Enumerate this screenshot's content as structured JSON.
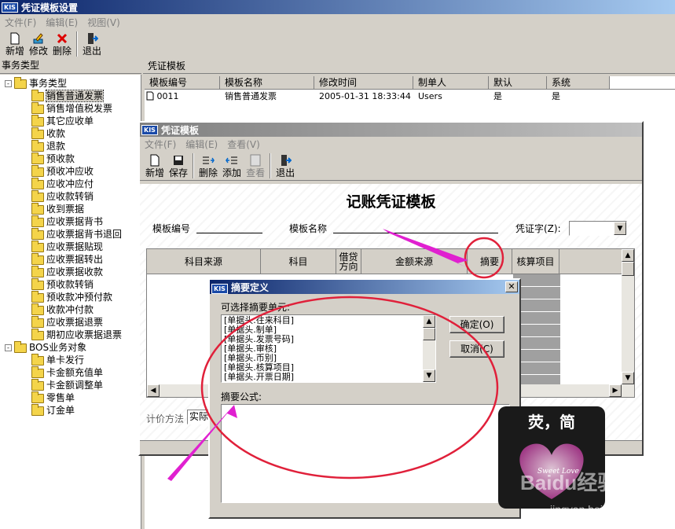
{
  "main_window": {
    "title": "凭证模板设置",
    "menus": [
      "文件(F)",
      "编辑(E)",
      "视图(V)"
    ],
    "toolbar": [
      "新增",
      "修改",
      "删除",
      "退出"
    ]
  },
  "left_panel": {
    "header": "事务类型",
    "tree": [
      {
        "label": "事务类型",
        "level": 0,
        "toggle": "-"
      },
      {
        "label": "销售普通发票",
        "level": 1,
        "selected": true
      },
      {
        "label": "销售增值税发票",
        "level": 1
      },
      {
        "label": "其它应收单",
        "level": 1
      },
      {
        "label": "收款",
        "level": 1
      },
      {
        "label": "退款",
        "level": 1
      },
      {
        "label": "预收款",
        "level": 1
      },
      {
        "label": "预收冲应收",
        "level": 1
      },
      {
        "label": "应收冲应付",
        "level": 1
      },
      {
        "label": "应收款转销",
        "level": 1
      },
      {
        "label": "收到票据",
        "level": 1
      },
      {
        "label": "应收票据背书",
        "level": 1
      },
      {
        "label": "应收票据背书退回",
        "level": 1
      },
      {
        "label": "应收票据贴现",
        "level": 1
      },
      {
        "label": "应收票据转出",
        "level": 1
      },
      {
        "label": "应收票据收款",
        "level": 1
      },
      {
        "label": "预收款转销",
        "level": 1
      },
      {
        "label": "预收款冲预付款",
        "level": 1
      },
      {
        "label": "收款冲付款",
        "level": 1
      },
      {
        "label": "应收票据退票",
        "level": 1
      },
      {
        "label": "期初应收票据退票",
        "level": 1
      },
      {
        "label": "BOS业务对象",
        "level": 0,
        "toggle": "-"
      },
      {
        "label": "单卡发行",
        "level": 1
      },
      {
        "label": "卡金额充值单",
        "level": 1
      },
      {
        "label": "卡金额调整单",
        "level": 1
      },
      {
        "label": "零售单",
        "level": 1
      },
      {
        "label": "订金单",
        "level": 1
      }
    ]
  },
  "right_panel": {
    "header": "凭证模板",
    "columns": [
      "模板编号",
      "模板名称",
      "修改时间",
      "制单人",
      "默认",
      "系统"
    ],
    "rows": [
      [
        "0011",
        "销售普通发票",
        "2005-01-31 18:33:44",
        "Users",
        "是",
        "是"
      ]
    ]
  },
  "voucher_window": {
    "title": "凭证模板",
    "menus": [
      "文件(F)",
      "编辑(E)",
      "查看(V)"
    ],
    "toolbar": [
      "新增",
      "保存",
      "删除",
      "添加",
      "查看",
      "退出"
    ],
    "heading": "记账凭证模板",
    "template_no_label": "模板编号",
    "template_name_label": "模板名称",
    "voucher_word_label": "凭证字(Z):",
    "grid_columns": [
      "科目来源",
      "科目",
      "借贷\n方向",
      "金额来源",
      "摘要",
      "核算项目"
    ],
    "bottom_label": "计价方法",
    "bottom_value": "实际"
  },
  "summary_dialog": {
    "title": "摘要定义",
    "available_label": "可选择摘要单元:",
    "items": [
      "[单据头.往来科目]",
      "[单据头.制单]",
      "[单据头.发票号码]",
      "[单据头.审核]",
      "[单据头.币别]",
      "[单据头.核算项目]",
      "[单据头.开票日期]"
    ],
    "ok_button": "确定(O)",
    "cancel_button": "取消(C)",
    "formula_label": "摘要公式:"
  },
  "watermark": {
    "stamp_text": "荧，简",
    "baidu": "Baidu经验",
    "url": "jingyan.baidu.com"
  },
  "colors": {
    "annotation": "#e020d0",
    "highlight_circle": "#e0203a",
    "title_active": "#0a246a"
  }
}
